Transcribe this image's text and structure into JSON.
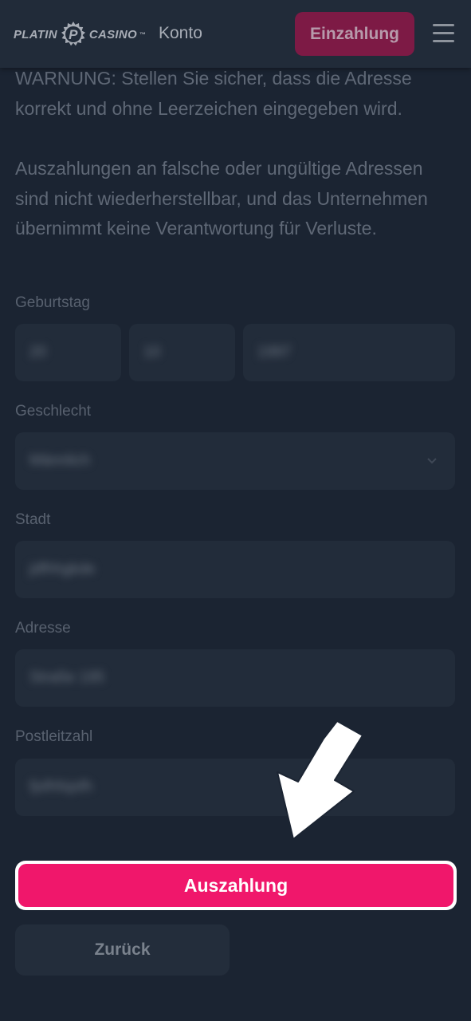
{
  "header": {
    "logo_left": "PLATIN",
    "logo_right": "CASINO",
    "logo_mark": "P",
    "logo_tm": "™",
    "nav_account": "Konto",
    "deposit_button": "Einzahlung",
    "menu_icon": "hamburger-menu-icon"
  },
  "warning": {
    "paragraph1": "WARNUNG: Stellen Sie sicher, dass die Adresse korrekt und ohne Leerzeichen eingegeben wird.",
    "paragraph2": "Auszahlungen an falsche oder ungültige Adressen sind nicht wiederherstellbar, und das Unternehmen übernimmt keine Verantwortung für Verluste."
  },
  "form": {
    "birthday": {
      "label": "Geburtstag",
      "day": "20",
      "month": "10",
      "year": "1997"
    },
    "gender": {
      "label": "Geschlecht",
      "value": "Männlich",
      "icon": "chevron-down-icon"
    },
    "city": {
      "label": "Stadt",
      "value": "jdfhhgkde"
    },
    "address": {
      "label": "Adresse",
      "value": "Straße 195"
    },
    "postal_code": {
      "label": "Postleitzahl",
      "value": "fjsfhfsjsfh"
    }
  },
  "actions": {
    "withdraw": "Auszahlung",
    "back": "Zurück"
  },
  "overlay": {
    "arrow_icon": "arrow-down-left-icon"
  },
  "colors": {
    "background": "#1b2432",
    "header": "#212b39",
    "field": "#222c3a",
    "accent": "#f0176b",
    "deposit_dimmed": "#7d1a45"
  }
}
